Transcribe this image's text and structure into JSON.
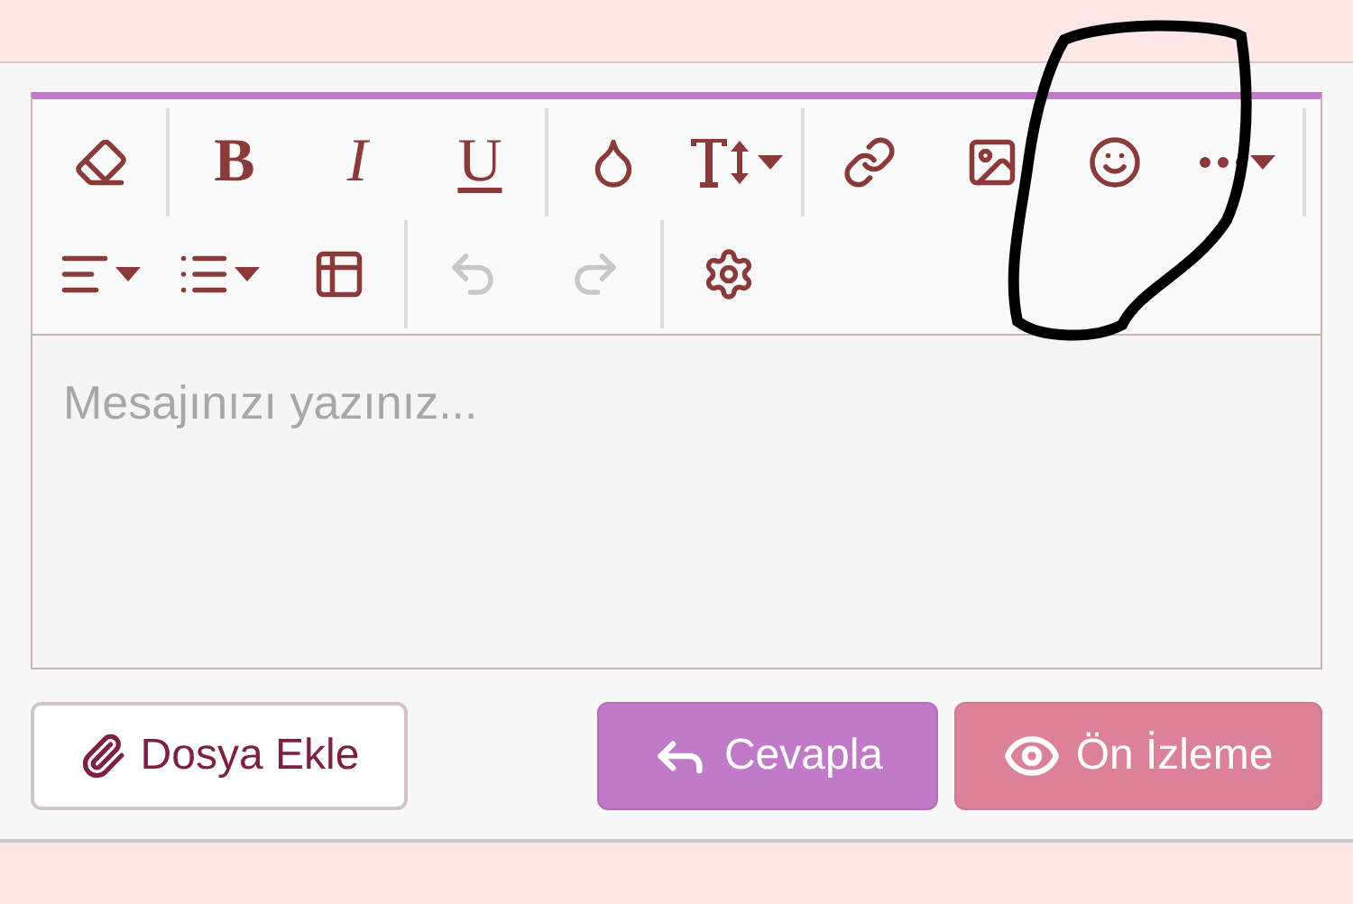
{
  "toolbar": {
    "rows": [
      [
        {
          "kind": "tool"
        },
        {
          "kind": "separator"
        },
        {
          "kind": "letter",
          "label": "B"
        },
        {
          "kind": "letter",
          "label": "I"
        },
        {
          "kind": "letter",
          "label": "U"
        },
        {
          "kind": "separator"
        },
        {
          "kind": "tool"
        },
        {
          "kind": "tool",
          "dropdown": true
        },
        {
          "kind": "separator"
        },
        {
          "kind": "tool"
        },
        {
          "kind": "tool"
        },
        {
          "kind": "tool"
        },
        {
          "kind": "tool",
          "dropdown": true
        },
        {
          "kind": "separator"
        }
      ],
      [
        {
          "kind": "tool",
          "dropdown": true
        },
        {
          "kind": "tool",
          "dropdown": true
        },
        {
          "kind": "tool"
        },
        {
          "kind": "separator"
        },
        {
          "kind": "tool",
          "disabled": true
        },
        {
          "kind": "tool",
          "disabled": true
        },
        {
          "kind": "separator"
        },
        {
          "kind": "tool"
        }
      ]
    ]
  },
  "editor": {
    "placeholder": "Mesajınızı yazınız..."
  },
  "buttons": [
    {
      "label": "Dosya Ekle",
      "kind": "attach"
    },
    {
      "label": "Cevapla",
      "kind": "reply"
    },
    {
      "label": "Ön İzleme",
      "kind": "preview"
    }
  ],
  "annotation": {
    "kind": "circle"
  }
}
